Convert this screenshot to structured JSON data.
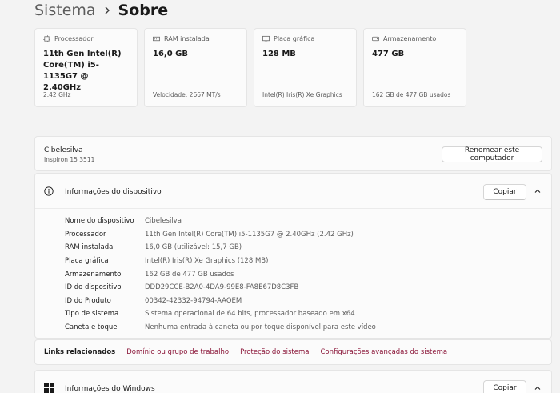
{
  "breadcrumb": {
    "parent": "Sistema",
    "separator": "›",
    "current": "Sobre"
  },
  "cards": [
    {
      "icon": "processor-icon",
      "title": "Processador",
      "value": "11th Gen Intel(R) Core(TM) i5-1135G7 @ 2.40GHz",
      "sub": "2.42 GHz"
    },
    {
      "icon": "ram-icon",
      "title": "RAM instalada",
      "value": "16,0 GB",
      "sub": "Velocidade: 2667 MT/s"
    },
    {
      "icon": "gpu-icon",
      "title": "Placa gráfica",
      "value": "128 MB",
      "sub": "Intel(R) Iris(R) Xe Graphics"
    },
    {
      "icon": "storage-icon",
      "title": "Armazenamento",
      "value": "477 GB",
      "sub": "162 GB de 477 GB usados"
    }
  ],
  "pc": {
    "name": "Cibelesilva",
    "model": "Inspiron 15 3511",
    "rename_label": "Renomear este computador"
  },
  "device": {
    "title": "Informações do dispositivo",
    "copy_label": "Copiar",
    "specs": [
      {
        "label": "Nome do dispositivo",
        "value": "Cibelesilva"
      },
      {
        "label": "Processador",
        "value": "11th Gen Intel(R) Core(TM) i5-1135G7 @ 2.40GHz (2.42 GHz)"
      },
      {
        "label": "RAM instalada",
        "value": "16,0 GB (utilizável: 15,7 GB)"
      },
      {
        "label": "Placa gráfica",
        "value": "Intel(R) Iris(R) Xe Graphics (128 MB)"
      },
      {
        "label": "Armazenamento",
        "value": "162 GB de 477 GB usados"
      },
      {
        "label": "ID do dispositivo",
        "value": "DDD29CCE-B2A0-4DA9-99E8-FA8E67D8C3FB"
      },
      {
        "label": "ID do Produto",
        "value": "00342-42332-94794-AAOEM"
      },
      {
        "label": "Tipo de sistema",
        "value": "Sistema operacional de 64 bits, processador baseado em x64"
      },
      {
        "label": "Caneta e toque",
        "value": "Nenhuma entrada à caneta ou por toque disponível para este vídeo"
      }
    ]
  },
  "links": {
    "label": "Links relacionados",
    "items": [
      "Domínio ou grupo de trabalho",
      "Proteção do sistema",
      "Configurações avançadas do sistema"
    ]
  },
  "windows": {
    "title": "Informações do Windows",
    "copy_label": "Copiar"
  },
  "colors": {
    "link": "#8a1538",
    "background": "#f3f3f3",
    "card": "#fbfbfb"
  }
}
